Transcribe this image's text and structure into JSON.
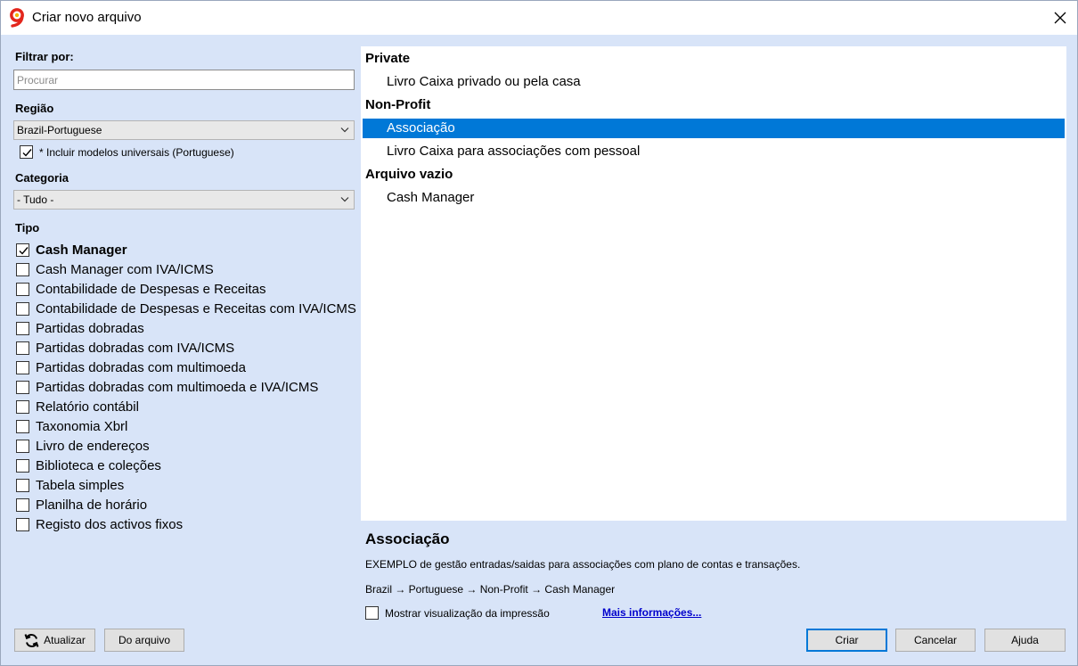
{
  "window": {
    "title": "Criar novo arquivo"
  },
  "filter": {
    "label": "Filtrar por:",
    "search_placeholder": "Procurar"
  },
  "region": {
    "label": "Região",
    "selected": "Brazil-Portuguese",
    "include_universal_label": "* Incluir modelos universais (Portuguese)",
    "include_universal_checked": true
  },
  "category": {
    "label": "Categoria",
    "selected": "- Tudo -"
  },
  "types": {
    "label": "Tipo",
    "items": [
      {
        "label": "Cash Manager",
        "checked": true
      },
      {
        "label": "Cash Manager com IVA/ICMS",
        "checked": false
      },
      {
        "label": "Contabilidade de Despesas e Receitas",
        "checked": false
      },
      {
        "label": "Contabilidade de Despesas e Receitas com IVA/ICMS",
        "checked": false
      },
      {
        "label": "Partidas dobradas",
        "checked": false
      },
      {
        "label": "Partidas dobradas com IVA/ICMS",
        "checked": false
      },
      {
        "label": "Partidas dobradas com multimoeda",
        "checked": false
      },
      {
        "label": "Partidas dobradas com multimoeda e IVA/ICMS",
        "checked": false
      },
      {
        "label": "Relatório contábil",
        "checked": false
      },
      {
        "label": "Taxonomia Xbrl",
        "checked": false
      },
      {
        "label": "Livro de endereços",
        "checked": false
      },
      {
        "label": "Biblioteca e coleções",
        "checked": false
      },
      {
        "label": "Tabela simples",
        "checked": false
      },
      {
        "label": "Planilha de horário",
        "checked": false
      },
      {
        "label": "Registo dos activos fixos",
        "checked": false
      }
    ]
  },
  "templates": {
    "groups": [
      {
        "name": "Private",
        "items": [
          "Livro Caixa privado ou pela casa"
        ]
      },
      {
        "name": "Non-Profit",
        "items": [
          "Associação",
          "Livro Caixa para associações com pessoal"
        ]
      },
      {
        "name": "Arquivo vazio",
        "items": [
          "Cash Manager"
        ]
      }
    ],
    "selected": "Associação"
  },
  "detail": {
    "title": "Associação",
    "description": "EXEMPLO de gestão entradas/saidas para associações com plano de contas e transações.",
    "path": "Brazil → Portuguese → Non-Profit → Cash Manager",
    "print_preview_label": "Mostrar visualização da impressão",
    "print_preview_checked": false,
    "more_info_link": "Mais informações..."
  },
  "buttons": {
    "refresh": "Atualizar",
    "from_file": "Do arquivo",
    "create": "Criar",
    "cancel": "Cancelar",
    "help": "Ajuda"
  },
  "colors": {
    "selection": "#0078d7",
    "window_bg": "#d8e4f8",
    "logo_red": "#e3261c"
  }
}
